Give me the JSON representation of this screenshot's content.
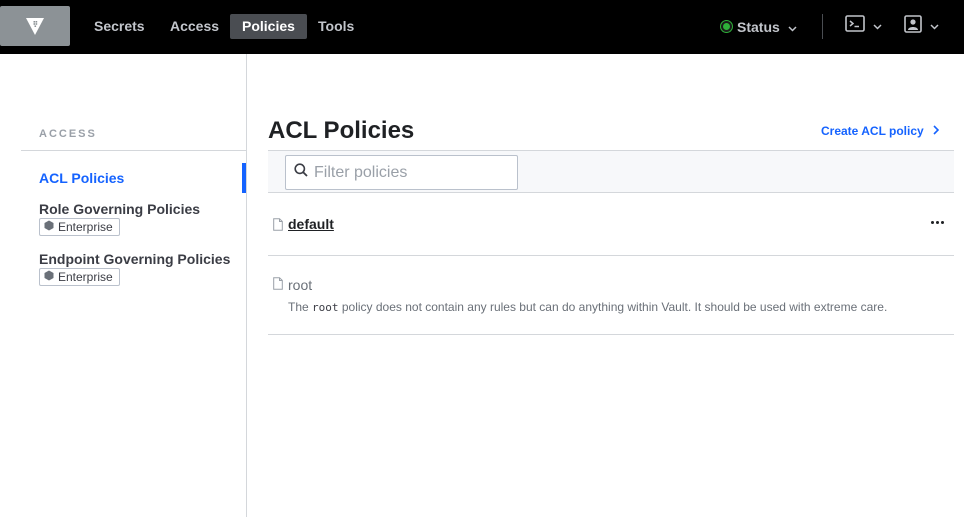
{
  "nav": {
    "items": [
      {
        "label": "Secrets"
      },
      {
        "label": "Access"
      },
      {
        "label": "Policies"
      },
      {
        "label": "Tools"
      }
    ],
    "active_index": 2,
    "status_label": "Status",
    "status_color": "#2eb039",
    "icons": [
      "vault-logo-icon",
      "console-icon",
      "user-icon",
      "chevron-down-icon"
    ]
  },
  "sidebar": {
    "heading": "ACCESS",
    "items": [
      {
        "label": "ACL Policies",
        "active": true
      },
      {
        "label": "Role Governing Policies",
        "badge": "Enterprise"
      },
      {
        "label": "Endpoint Governing Policies",
        "badge": "Enterprise"
      }
    ]
  },
  "main": {
    "title": "ACL Policies",
    "create_label": "Create ACL policy",
    "filter_placeholder": "Filter policies",
    "filter_value": "",
    "policies": [
      {
        "name": "default"
      },
      {
        "name": "root",
        "desc_prefix": "The ",
        "desc_code": "root",
        "desc_suffix": " policy does not contain any rules but can do anything within Vault. It should be used with extreme care."
      }
    ]
  },
  "colors": {
    "accent": "#1563ff",
    "topbar": "#000000",
    "active_nav_bg": "#4a4d52"
  }
}
